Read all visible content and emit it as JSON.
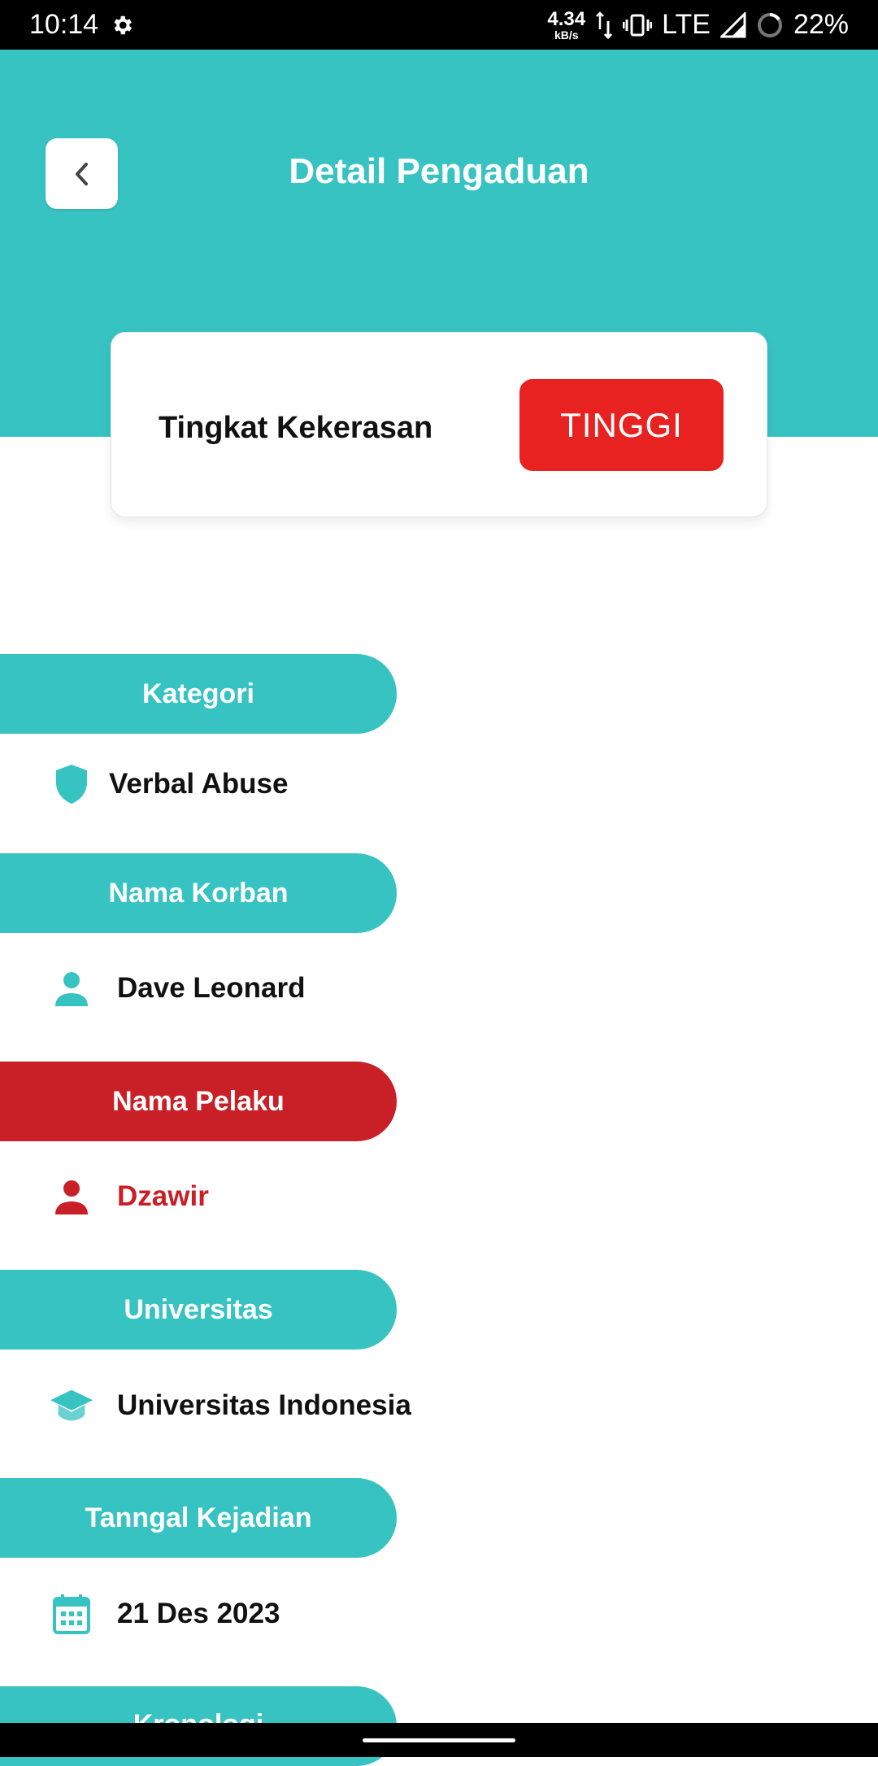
{
  "status_bar": {
    "time": "10:14",
    "net_speed_value": "4.34",
    "net_speed_unit": "kB/s",
    "network": "LTE",
    "battery": "22%"
  },
  "header": {
    "title": "Detail Pengaduan",
    "color": "#38C3C3"
  },
  "severity": {
    "label": "Tingkat Kekerasan",
    "value": "TINGGI",
    "badge_color": "#E82121"
  },
  "fields": [
    {
      "heading": "Kategori",
      "value": "Verbal Abuse",
      "icon": "shield-icon"
    },
    {
      "heading": "Nama Korban",
      "value": "Dave Leonard",
      "icon": "person-icon"
    },
    {
      "heading": "Nama Pelaku",
      "value": "Dzawir",
      "icon": "person-icon",
      "accent": "#C92027"
    },
    {
      "heading": "Universitas",
      "value": "Universitas Indonesia",
      "icon": "graduation-cap-icon"
    },
    {
      "heading": "Tanngal Kejadian",
      "value": "21 Des 2023",
      "icon": "calendar-icon"
    },
    {
      "heading": "Kronologi",
      "value": "",
      "icon": ""
    }
  ]
}
